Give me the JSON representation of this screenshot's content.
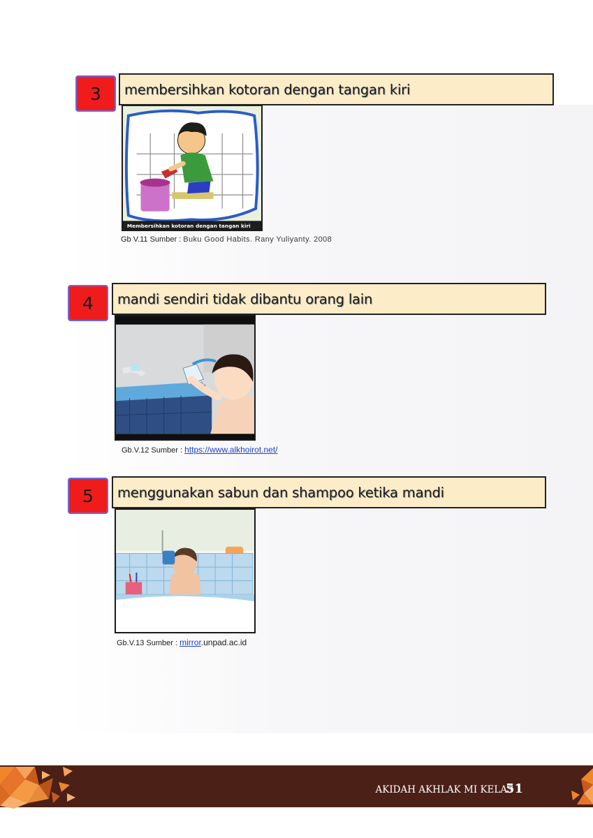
{
  "items": [
    {
      "number": "3",
      "title": "membersihkan kotoran dengan tangan kiri",
      "caption_label": "Gb V.11 Sumber :",
      "caption_source": "Buku Good Habits. Rany Yuliyanty. 2008",
      "image_text": "Membersihkan kotoran dengan tangan kiri"
    },
    {
      "number": "4",
      "title": "mandi sendiri tidak dibantu orang lain",
      "caption_label": "Gb.V.12 Sumber :",
      "caption_link": "https://www.alkhoirot.net/"
    },
    {
      "number": "5",
      "title": "menggunakan sabun dan shampoo ketika mandi",
      "caption_label": "Gb.V.13 Sumber :",
      "caption_link": "mirror",
      "caption_suffix": ".unpad.ac.id"
    }
  ],
  "footer": {
    "book_title": "AKIDAH AKHLAK MI KELAS I",
    "page_number": "51"
  },
  "colors": {
    "number_box": "#f01c1c",
    "title_box": "#fcecc8",
    "footer": "#4b2016",
    "accent_orange": "#f0862a",
    "link": "#1a3fd0"
  }
}
